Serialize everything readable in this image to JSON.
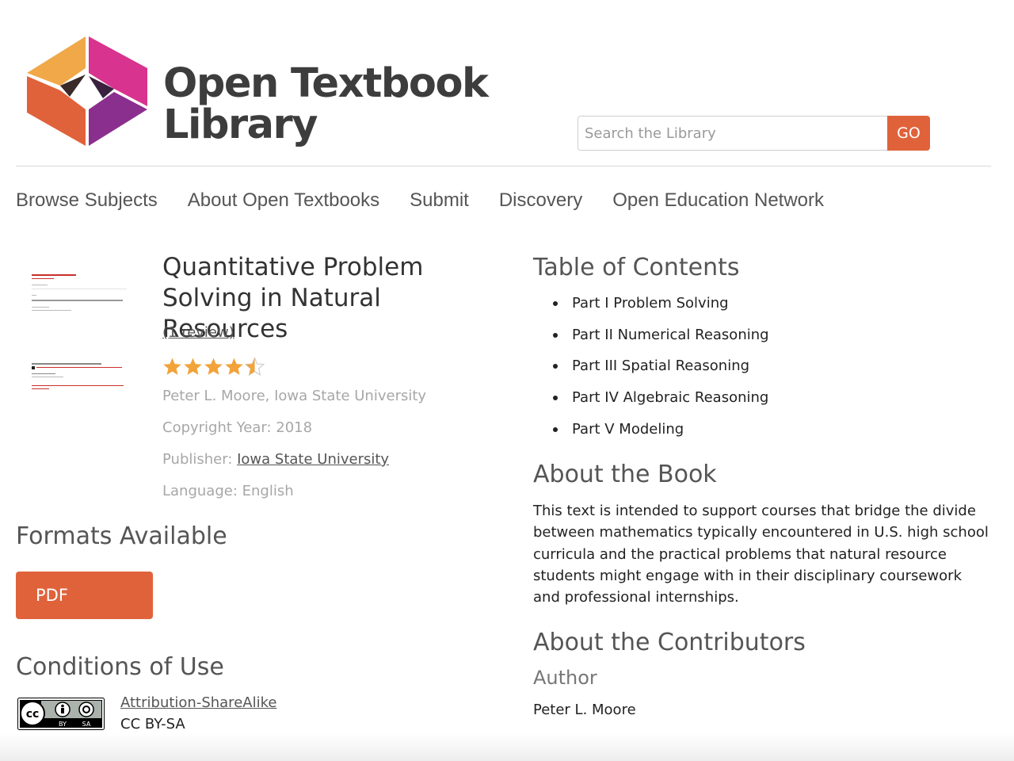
{
  "header": {
    "logo_line1": "Open Textbook",
    "logo_line2": "Library",
    "search_placeholder": "Search the Library",
    "search_button": "GO"
  },
  "nav": {
    "items": [
      "Browse Subjects",
      "About Open Textbooks",
      "Submit",
      "Discovery",
      "Open Education Network"
    ]
  },
  "book": {
    "title": "Quantitative Problem Solving in Natural Resources",
    "reviews": "(1 review)",
    "rating": 4.5,
    "rating_max": 5,
    "author": "Peter L. Moore, Iowa State University",
    "copyright": "Copyright Year: 2018",
    "publisher_label": "Publisher: ",
    "publisher": "Iowa State University",
    "language": "Language: English"
  },
  "formats": {
    "heading": "Formats Available",
    "buttons": [
      "PDF"
    ]
  },
  "conditions": {
    "heading": "Conditions of Use",
    "license_name": "Attribution-ShareAlike",
    "license_code": "CC BY-SA",
    "badge_text": [
      "cc",
      "BY",
      "SA"
    ]
  },
  "toc": {
    "heading": "Table of Contents",
    "items": [
      "Part I Problem Solving",
      "Part II Numerical Reasoning",
      "Part III Spatial Reasoning",
      "Part IV Algebraic Reasoning",
      "Part V Modeling"
    ]
  },
  "about_book": {
    "heading": "About the Book",
    "text": "This text is intended to support courses that bridge the divide between mathematics typically encountered in U.S. high school curricula and the practical problems that natural resource students might engage with in their disciplinary coursework and professional internships."
  },
  "contributors": {
    "heading": "About the Contributors",
    "subheading": "Author",
    "name": "Peter L. Moore"
  },
  "colors": {
    "accent": "#e0623b",
    "star": "#f2a33a",
    "logo_orange": "#f0a848",
    "logo_magenta": "#d8338e",
    "logo_red": "#e0623b",
    "logo_purple": "#8b2f8f"
  }
}
